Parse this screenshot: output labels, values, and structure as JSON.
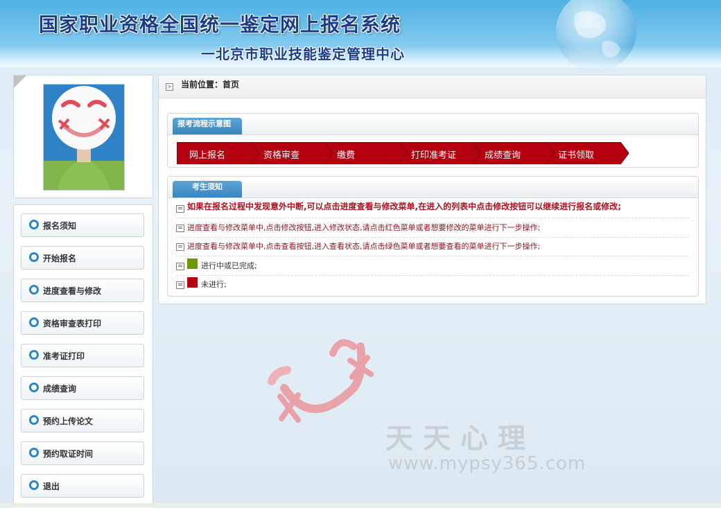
{
  "header": {
    "title": "国家职业资格全国统一鉴定网上报名系统",
    "subtitle": "一北京市职业技能鉴定管理中心"
  },
  "sidebar": {
    "items": [
      {
        "label": "报名须知"
      },
      {
        "label": "开始报名"
      },
      {
        "label": "进度查看与修改"
      },
      {
        "label": "资格审查表打印"
      },
      {
        "label": "准考证打印"
      },
      {
        "label": "成绩查询"
      },
      {
        "label": "预约上传论文"
      },
      {
        "label": "预约取证时间"
      },
      {
        "label": "退出"
      }
    ]
  },
  "breadcrumb": {
    "text": "当前位置：首页"
  },
  "flow_section": {
    "tab": "报考流程示意图",
    "steps": [
      {
        "label": "网上报名"
      },
      {
        "label": "资格审查"
      },
      {
        "label": "缴费"
      },
      {
        "label": "打印准考证"
      },
      {
        "label": "成绩查询"
      },
      {
        "label": "证书领取"
      }
    ],
    "step_color": "#b5000f"
  },
  "notice_section": {
    "tab": "考生须知",
    "lines": [
      "如果在报名过程中发现意外中断,可以点击进度查看与修改菜单,在进入的列表中点击修改按钮可以继续进行报名或修改;",
      "进度查看与修改菜单中,点击修改按钮,进入修改状态,请点击红色菜单或者想要修改的菜单进行下一步操作;",
      "进度查看与修改菜单中,点击查看按钮,进入查看状态,请点击绿色菜单或者想要查看的菜单进行下一步操作;"
    ],
    "legend": [
      {
        "color": "#6a9a00",
        "label": "进行中或已完成;"
      },
      {
        "color": "#b5000f",
        "label": "未进行;"
      }
    ]
  },
  "watermark": {
    "text": "天天心理",
    "url": "www.mypsy365.com"
  }
}
